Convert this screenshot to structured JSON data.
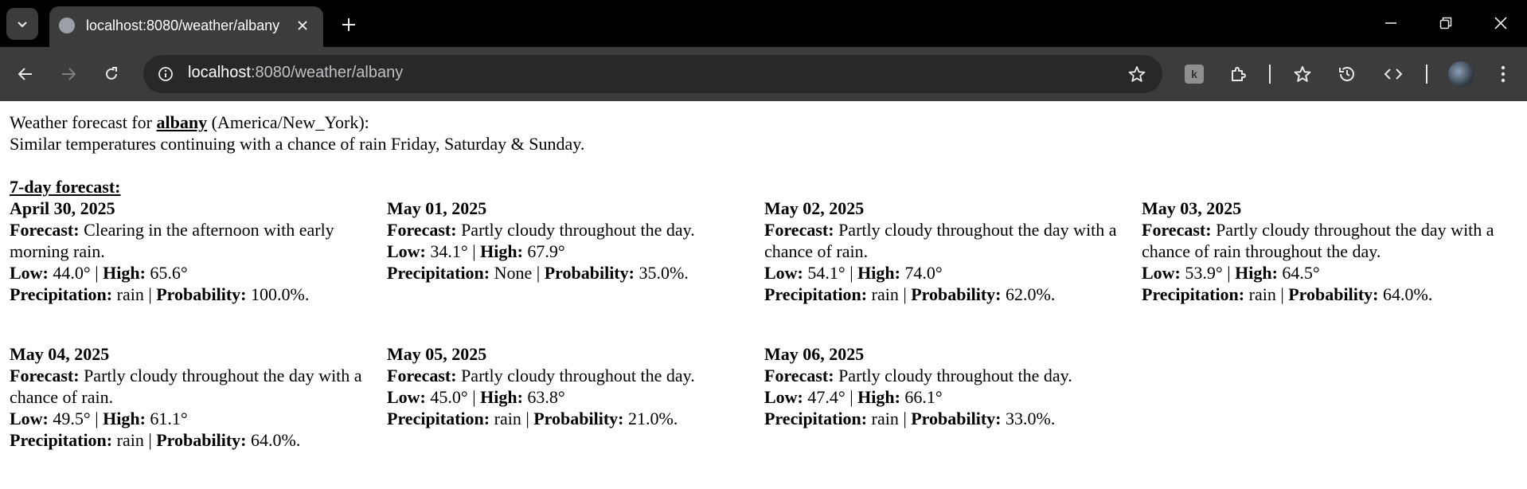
{
  "browser": {
    "tab_title": "localhost:8080/weather/albany",
    "url_host": "localhost",
    "url_path": ":8080/weather/albany",
    "extension_badge": "k"
  },
  "page": {
    "intro_prefix": "Weather forecast for ",
    "city": "albany",
    "timezone": " (America/New_York):",
    "summary": "Similar temperatures continuing with a chance of rain Friday, Saturday & Sunday.",
    "section_title": "7-day forecast:",
    "labels": {
      "forecast": "Forecast:",
      "low": "Low:",
      "high": "High:",
      "precipitation": "Precipitation:",
      "probability": "Probability:",
      "separator": " | "
    },
    "days": [
      {
        "date": "April 30, 2025",
        "forecast": "Clearing in the afternoon with early morning rain.",
        "low": "44.0°",
        "high": "65.6°",
        "precip": "rain",
        "probability": "100.0%."
      },
      {
        "date": "May 01, 2025",
        "forecast": "Partly cloudy throughout the day.",
        "low": "34.1°",
        "high": "67.9°",
        "precip": "None",
        "probability": "35.0%."
      },
      {
        "date": "May 02, 2025",
        "forecast": "Partly cloudy throughout the day with a chance of rain.",
        "low": "54.1°",
        "high": "74.0°",
        "precip": "rain",
        "probability": "62.0%."
      },
      {
        "date": "May 03, 2025",
        "forecast": "Partly cloudy throughout the day with a chance of rain throughout the day.",
        "low": "53.9°",
        "high": "64.5°",
        "precip": "rain",
        "probability": "64.0%."
      },
      {
        "date": "May 04, 2025",
        "forecast": "Partly cloudy throughout the day with a chance of rain.",
        "low": "49.5°",
        "high": "61.1°",
        "precip": "rain",
        "probability": "64.0%."
      },
      {
        "date": "May 05, 2025",
        "forecast": "Partly cloudy throughout the day.",
        "low": "45.0°",
        "high": "63.8°",
        "precip": "rain",
        "probability": "21.0%."
      },
      {
        "date": "May 06, 2025",
        "forecast": "Partly cloudy throughout the day.",
        "low": "47.4°",
        "high": "66.1°",
        "precip": "rain",
        "probability": "33.0%."
      }
    ]
  }
}
